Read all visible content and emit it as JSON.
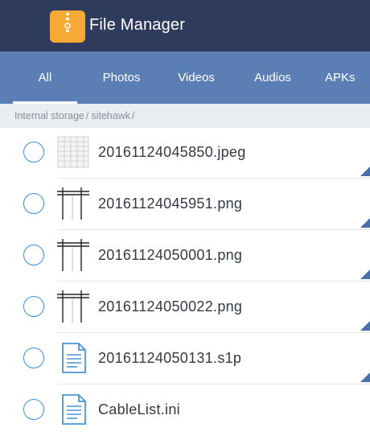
{
  "app": {
    "title": "File Manager",
    "icon": "folder-zipper-icon"
  },
  "tabs": [
    {
      "label": "All",
      "active": true
    },
    {
      "label": "Photos",
      "active": false
    },
    {
      "label": "Videos",
      "active": false
    },
    {
      "label": "Audios",
      "active": false
    },
    {
      "label": "APKs",
      "active": false
    }
  ],
  "breadcrumb": [
    {
      "label": "Internal storage",
      "sep": "/"
    },
    {
      "label": "sitehawk",
      "sep": "/"
    }
  ],
  "files": [
    {
      "name": "20161124045850.jpeg",
      "icon": "image-grid-thumbnail-icon",
      "checked": false
    },
    {
      "name": "20161124045951.png",
      "icon": "image-table-thumbnail-icon",
      "checked": false
    },
    {
      "name": "20161124050001.png",
      "icon": "image-table-thumbnail-icon",
      "checked": false
    },
    {
      "name": "20161124050022.png",
      "icon": "image-table-thumbnail-icon",
      "checked": false
    },
    {
      "name": "20161124050131.s1p",
      "icon": "document-icon",
      "checked": false
    },
    {
      "name": "CableList.ini",
      "icon": "document-icon",
      "checked": false
    }
  ],
  "colors": {
    "topbar": "#2f3b5c",
    "tabbar": "#5b7fb5",
    "accent": "#3c8fd8",
    "app_icon": "#f7a936",
    "breadcrumb_bg": "#eaeef3"
  }
}
